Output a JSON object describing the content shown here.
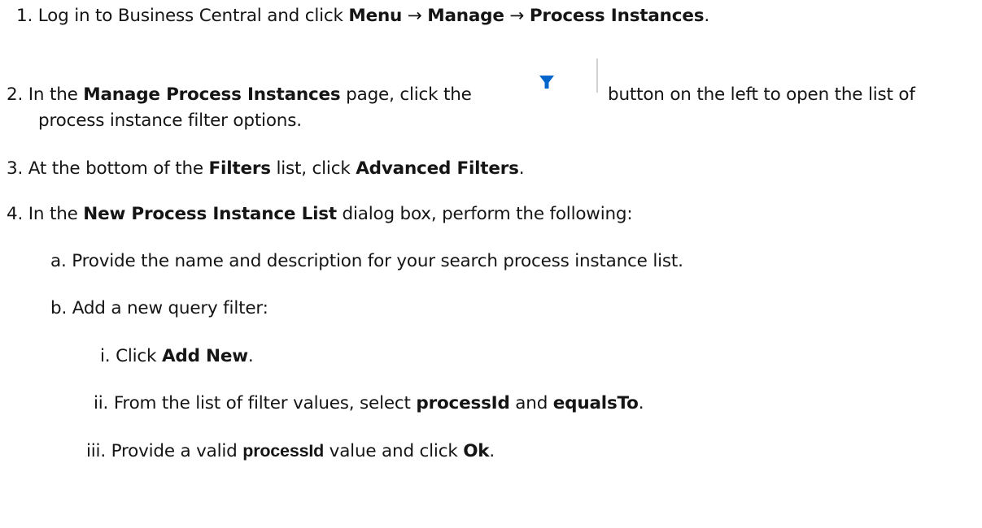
{
  "steps": [
    {
      "num": "1.",
      "t1": "Log in to Business Central and click ",
      "b1": "Menu",
      "t2": " → ",
      "b2": "Manage",
      "t3": " → ",
      "b3": "Process Instances",
      "t4": "."
    },
    {
      "num": "2.",
      "t1": "In the ",
      "b1": "Manage Process Instances",
      "t2": " page, click the",
      "t3": "button on the left to open the list of",
      "cont": "process instance filter options."
    },
    {
      "num": "3.",
      "t1": "At the bottom of the ",
      "b1": "Filters",
      "t2": " list, click ",
      "b2": "Advanced Filters",
      "t3": "."
    },
    {
      "num": "4.",
      "t1": "In the ",
      "b1": "New Process Instance List",
      "t2": " dialog box, perform the following:"
    }
  ],
  "substeps": [
    {
      "num": "a.",
      "t1": "Provide the name and description for your search process instance list."
    },
    {
      "num": "b.",
      "t1": "Add a new query filter:"
    }
  ],
  "subsubsteps": [
    {
      "num": "i.",
      "t1": "Click ",
      "b1": "Add New",
      "t2": "."
    },
    {
      "num": "ii.",
      "t1": "From the list of filter values, select ",
      "b1": "processId",
      "t2": " and ",
      "b2": "equalsTo",
      "t3": "."
    },
    {
      "num": "iii.",
      "t1": "Provide a valid ",
      "b1": "processId",
      "t2": " value and click ",
      "b2": "Ok",
      "t3": "."
    }
  ],
  "filter_button": {
    "icon": "filter-funnel-icon",
    "color": "#0066cc"
  }
}
